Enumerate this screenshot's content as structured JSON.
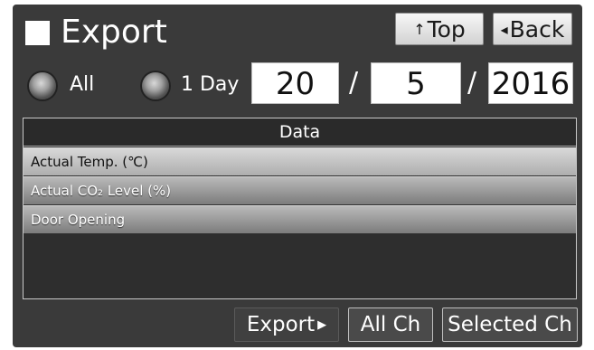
{
  "header": {
    "title": "Export",
    "top_arrow": "↑",
    "top_label": "Top",
    "back_arrow": "◂",
    "back_label": "Back"
  },
  "range": {
    "all_label": "All",
    "one_day_label": "1 Day",
    "day": "20",
    "month": "5",
    "year": "2016",
    "separator": "/"
  },
  "data_panel": {
    "header": "Data",
    "items": [
      {
        "label": "Actual Temp. (℃)",
        "selected": true
      },
      {
        "label": "Actual CO₂ Level (%)",
        "selected": false
      },
      {
        "label": "Door Opening",
        "selected": false
      }
    ]
  },
  "footer": {
    "export_label": "Export",
    "export_icon": "▶",
    "all_ch_label": "All Ch",
    "selected_ch_label": "Selected Ch"
  },
  "icons": {
    "title_marker": "square-icon",
    "top": "up-arrow-icon",
    "back": "left-triangle-icon",
    "export": "right-triangle-icon"
  },
  "colors": {
    "screen_bg": "#3a3a3a",
    "button_face": "#e6e6e6",
    "row_bg": "#8f8f8f",
    "text": "#ffffff"
  }
}
